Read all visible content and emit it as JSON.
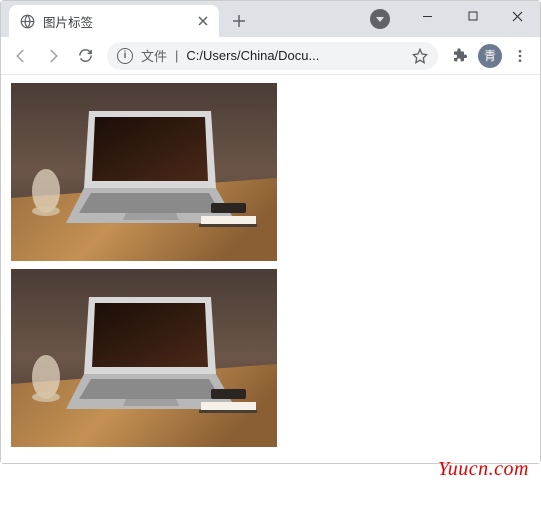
{
  "tab": {
    "title": "图片标签"
  },
  "addressbar": {
    "protocol_label": "文件",
    "url": "C:/Users/China/Docu..."
  },
  "avatar": {
    "label": "青"
  },
  "watermark": "Yuucn.com",
  "images": {
    "alt1": "laptop on wooden desk with glass and phone",
    "alt2": "laptop on wooden desk with glass and phone"
  }
}
